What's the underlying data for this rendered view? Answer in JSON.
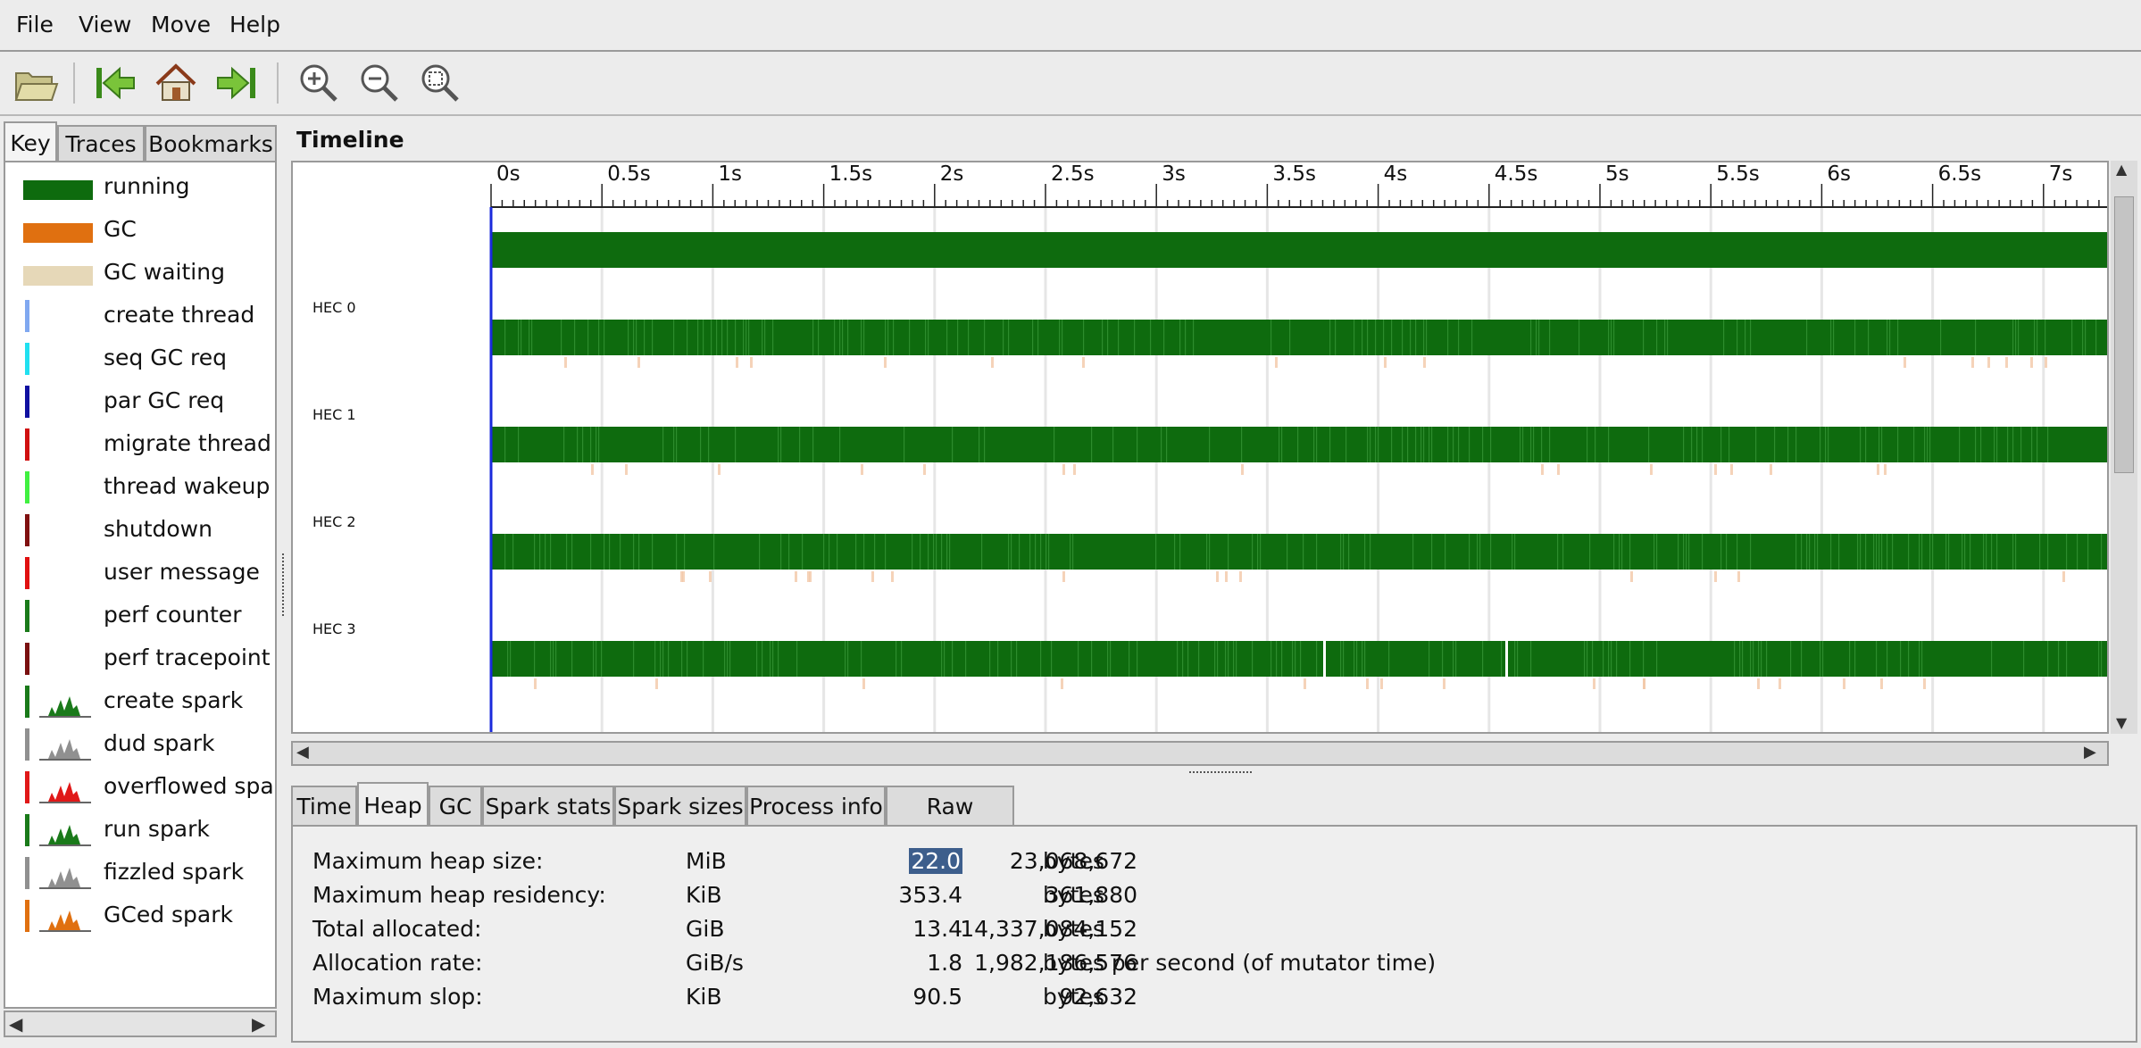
{
  "menu": [
    "File",
    "View",
    "Move",
    "Help"
  ],
  "toolbar": {
    "icons": [
      "open-icon",
      "jump-start-icon",
      "home-icon",
      "jump-end-icon",
      "zoom-in-icon",
      "zoom-out-icon",
      "zoom-fit-icon"
    ]
  },
  "left_tabs": [
    "Key",
    "Traces",
    "Bookmarks"
  ],
  "key": [
    {
      "label": "running",
      "kind": "swatch",
      "color": "#0e6b0e"
    },
    {
      "label": "GC",
      "kind": "swatch",
      "color": "#e07010"
    },
    {
      "label": "GC waiting",
      "kind": "swatch",
      "color": "#e6d8b8"
    },
    {
      "label": "create thread",
      "kind": "tick",
      "color": "#80a8f0"
    },
    {
      "label": "seq GC req",
      "kind": "tick",
      "color": "#20e0f0"
    },
    {
      "label": "par GC req",
      "kind": "tick",
      "color": "#1010a0"
    },
    {
      "label": "migrate thread",
      "kind": "tick",
      "color": "#d01010"
    },
    {
      "label": "thread wakeup",
      "kind": "tick",
      "color": "#40f040"
    },
    {
      "label": "shutdown",
      "kind": "tick",
      "color": "#801010"
    },
    {
      "label": "user message",
      "kind": "tick",
      "color": "#e01010"
    },
    {
      "label": "perf counter",
      "kind": "tick",
      "color": "#1a7a1a"
    },
    {
      "label": "perf tracepoint",
      "kind": "tick",
      "color": "#7a1010"
    },
    {
      "label": "create spark",
      "kind": "spark",
      "color": "#1a7a1a"
    },
    {
      "label": "dud spark",
      "kind": "spark",
      "color": "#909090"
    },
    {
      "label": "overflowed spark",
      "kind": "spark",
      "color": "#e01818"
    },
    {
      "label": "run spark",
      "kind": "spark",
      "color": "#1a7a1a"
    },
    {
      "label": "fizzled spark",
      "kind": "spark",
      "color": "#909090"
    },
    {
      "label": "GCed spark",
      "kind": "spark",
      "color": "#e07010"
    }
  ],
  "timeline": {
    "title": "Timeline",
    "ticks": [
      "0s",
      "0.5s",
      "1s",
      "1.5s",
      "2s",
      "2.5s",
      "3s",
      "3.5s",
      "4s",
      "4.5s",
      "5s",
      "5.5s",
      "6s",
      "6.5s",
      "7s"
    ],
    "hecs": [
      "HEC 0",
      "HEC 1",
      "HEC 2",
      "HEC 3"
    ],
    "running_color": "#0e6b0e"
  },
  "bottom_tabs": [
    "Time",
    "Heap",
    "GC",
    "Spark stats",
    "Spark sizes",
    "Process info",
    "Raw events"
  ],
  "heap": [
    {
      "label": "Maximum heap size:",
      "value": "22.0",
      "unit": "MiB",
      "bytes": "23,068,672",
      "bytes_unit": "bytes"
    },
    {
      "label": "Maximum heap residency:",
      "value": "353.4",
      "unit": "KiB",
      "bytes": "361,880",
      "bytes_unit": "bytes"
    },
    {
      "label": "Total allocated:",
      "value": "13.4",
      "unit": "GiB",
      "bytes": "14,337,084,152",
      "bytes_unit": "bytes"
    },
    {
      "label": "Allocation rate:",
      "value": "1.8",
      "unit": "GiB/s",
      "bytes": "1,982,186,576",
      "bytes_unit": "bytes per second (of mutator time)"
    },
    {
      "label": "Maximum slop:",
      "value": "90.5",
      "unit": "KiB",
      "bytes": "92,632",
      "bytes_unit": "bytes"
    }
  ]
}
